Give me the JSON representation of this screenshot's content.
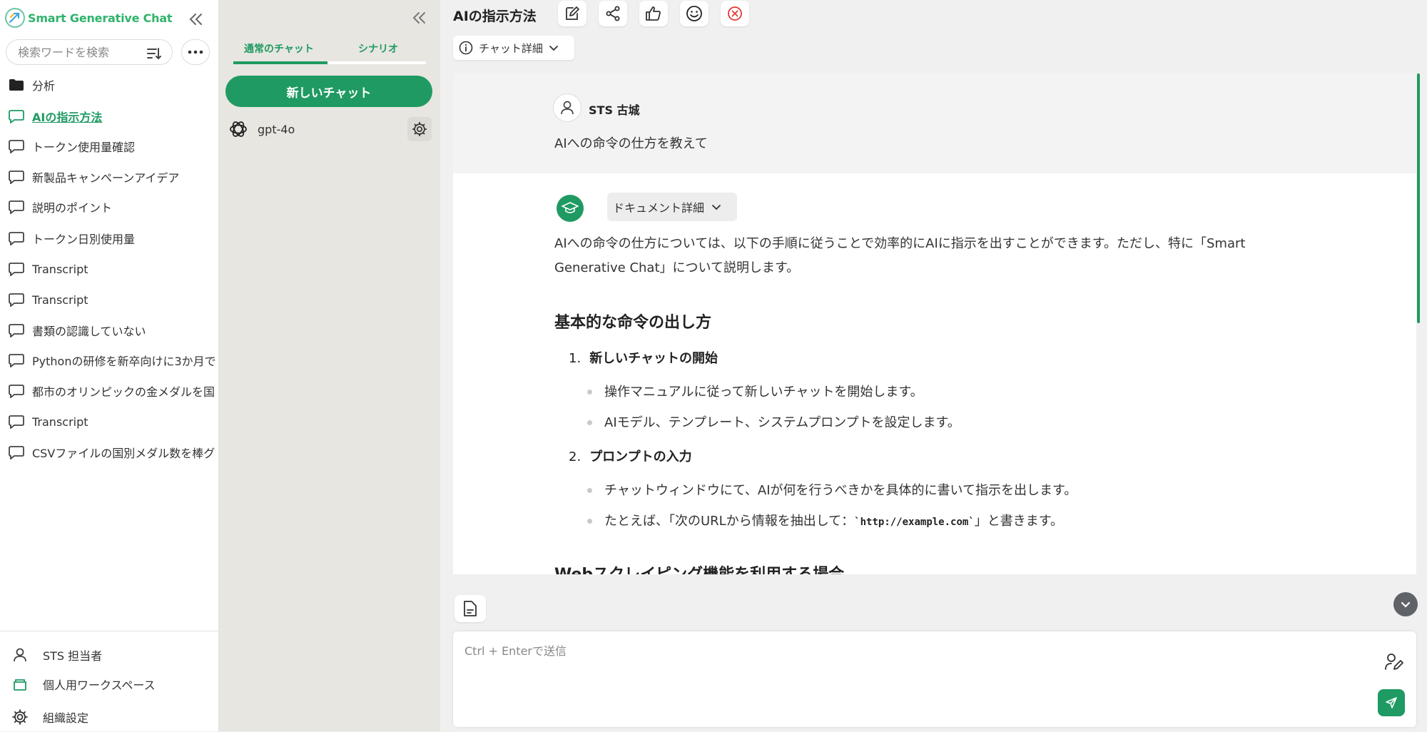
{
  "brand": {
    "name": "Smart Generative Chat"
  },
  "search": {
    "placeholder": "検索ワードを検索"
  },
  "sidebar": {
    "items": [
      {
        "label": "分析",
        "icon": "folder-icon"
      },
      {
        "label": "AIの指示方法",
        "icon": "chat-bubble-icon",
        "active": true
      },
      {
        "label": "トークン使用量確認",
        "icon": "chat-bubble-icon"
      },
      {
        "label": "新製品キャンペーンアイデア",
        "icon": "chat-bubble-icon"
      },
      {
        "label": "説明のポイント",
        "icon": "chat-bubble-icon"
      },
      {
        "label": "トークン日別使用量",
        "icon": "chat-bubble-icon"
      },
      {
        "label": "Transcript",
        "icon": "chat-bubble-icon"
      },
      {
        "label": "Transcript",
        "icon": "chat-bubble-icon"
      },
      {
        "label": "書類の認識していない",
        "icon": "chat-bubble-icon"
      },
      {
        "label": "Pythonの研修を新卒向けに3か月で",
        "icon": "chat-bubble-icon"
      },
      {
        "label": "都市のオリンピックの金メダルを国",
        "icon": "chat-bubble-icon"
      },
      {
        "label": "Transcript",
        "icon": "chat-bubble-icon"
      },
      {
        "label": "CSVファイルの国別メダル数を棒グ",
        "icon": "chat-bubble-icon"
      }
    ],
    "footer": {
      "user": "STS 担当者",
      "workspace": "個人用ワークスペース",
      "org_settings": "組織設定"
    }
  },
  "panel": {
    "tabs": [
      "通常のチャット",
      "シナリオ"
    ],
    "new_chat": "新しいチャット",
    "model": "gpt-4o"
  },
  "main": {
    "title": "AIの指示方法",
    "chat_detail": "チャット詳細",
    "doc_detail": "ドキュメント詳細",
    "user": {
      "name": "STS 古城",
      "message": "AIへの命令の仕方を教えて"
    },
    "answer": {
      "intro": "AIへの命令の仕方については、以下の手順に従うことで効率的にAIに指示を出すことができます。ただし、特に「Smart Generative Chat」について説明します。",
      "heading1": "基本的な命令の出し方",
      "step1_num": "1.",
      "step1": "新しいチャットの開始",
      "step1_bullets": [
        "操作マニュアルに従って新しいチャットを開始します。",
        "AIモデル、テンプレート、システムプロンプトを設定します。"
      ],
      "step2_num": "2.",
      "step2": "プロンプトの入力",
      "step2_bullet1": "チャットウィンドウにて、AIが何を行うべきかを具体的に書いて指示を出します。",
      "step2_bullet2_pre": "たとえば、「次のURLから情報を抽出して：",
      "step2_bullet2_code": "`http://example.com`",
      "step2_bullet2_post": "」と書きます。",
      "heading2": "Webスクレイピング機能を利用する場合"
    },
    "input": {
      "placeholder": "Ctrl + Enterで送信"
    }
  },
  "colors": {
    "accent": "#1f9a62",
    "danger": "#e53935"
  }
}
